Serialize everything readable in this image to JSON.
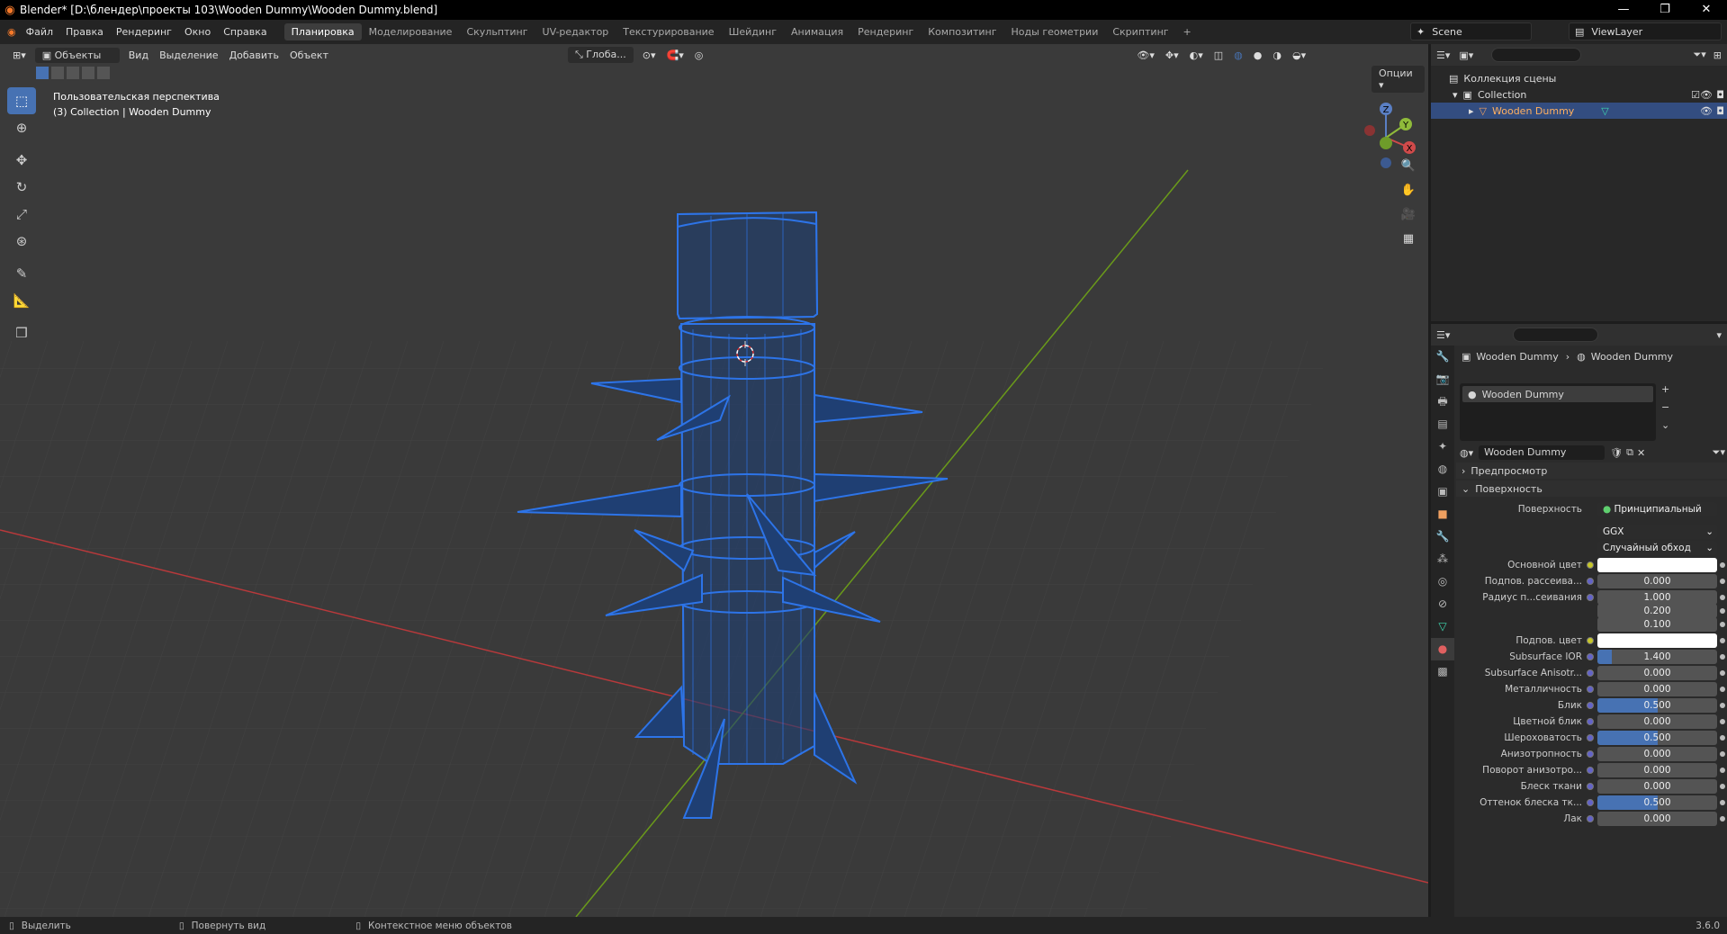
{
  "window": {
    "title": "Blender* [D:\\блендер\\проекты 103\\Wooden Dummy\\Wooden Dummy.blend]",
    "minimize": "—",
    "maximize": "❐",
    "close": "✕"
  },
  "menus": [
    "Файл",
    "Правка",
    "Рендеринг",
    "Окно",
    "Справка"
  ],
  "workspaces": [
    "Планировка",
    "Моделирование",
    "Скульптинг",
    "UV-редактор",
    "Текстурирование",
    "Шейдинг",
    "Анимация",
    "Рендеринг",
    "Композитинг",
    "Ноды геометрии",
    "Скриптинг",
    "+"
  ],
  "scene": {
    "name": "Scene",
    "view_layer": "ViewLayer"
  },
  "viewport": {
    "mode": "Объекты",
    "menus": [
      "Вид",
      "Выделение",
      "Добавить",
      "Объект"
    ],
    "orientation": "Глоба...",
    "options": "Опции",
    "view_name": "Пользовательская перспектива",
    "collection_info": "(3) Collection | Wooden Dummy",
    "gizmo": {
      "x": "X",
      "y": "Y",
      "z": "Z"
    }
  },
  "outliner": {
    "root": "Коллекция сцены",
    "collection": "Collection",
    "object": "Wooden Dummy"
  },
  "properties": {
    "breadcrumb_object": "Wooden Dummy",
    "breadcrumb_material": "Wooden Dummy",
    "slot_name": "Wooden Dummy",
    "material_name": "Wooden Dummy",
    "preview": "Предпросмотр",
    "surface_section": "Поверхность",
    "surface_label": "Поверхность",
    "surface_value": "Принципиальный BSDF",
    "distribution": "GGX",
    "subsurface_method": "Случайный обход",
    "rows": [
      {
        "label": "Основной цвет",
        "value": "",
        "fill": 0,
        "color": "#ffffff"
      },
      {
        "label": "Подпов. рассеива...",
        "value": "0.000",
        "fill": 0
      },
      {
        "label": "Радиус п...сеивания",
        "value": "1.000",
        "fill": 0
      },
      {
        "label": "",
        "value": "0.200",
        "fill": 0
      },
      {
        "label": "",
        "value": "0.100",
        "fill": 0
      },
      {
        "label": "Подпов. цвет",
        "value": "",
        "fill": 0,
        "color": "#ffffff"
      },
      {
        "label": "Subsurface IOR",
        "value": "1.400",
        "fill": 0.12
      },
      {
        "label": "Subsurface Anisotr...",
        "value": "0.000",
        "fill": 0
      },
      {
        "label": "Металличность",
        "value": "0.000",
        "fill": 0
      },
      {
        "label": "Блик",
        "value": "0.500",
        "fill": 0.5
      },
      {
        "label": "Цветной блик",
        "value": "0.000",
        "fill": 0
      },
      {
        "label": "Шероховатость",
        "value": "0.500",
        "fill": 0.5
      },
      {
        "label": "Анизотропность",
        "value": "0.000",
        "fill": 0
      },
      {
        "label": "Поворот анизотро...",
        "value": "0.000",
        "fill": 0
      },
      {
        "label": "Блеск ткани",
        "value": "0.000",
        "fill": 0
      },
      {
        "label": "Оттенок блеска тк...",
        "value": "0.500",
        "fill": 0.5
      },
      {
        "label": "Лак",
        "value": "0.000",
        "fill": 0
      }
    ]
  },
  "statusbar": {
    "select": "Выделить",
    "rotate": "Повернуть вид",
    "context": "Контекстное меню объектов",
    "version": "3.6.0"
  },
  "colors": {
    "accent": "#4772b3",
    "wire": "#2d74e8",
    "x_axis": "#b8393b",
    "y_axis": "#6a9a1a"
  }
}
